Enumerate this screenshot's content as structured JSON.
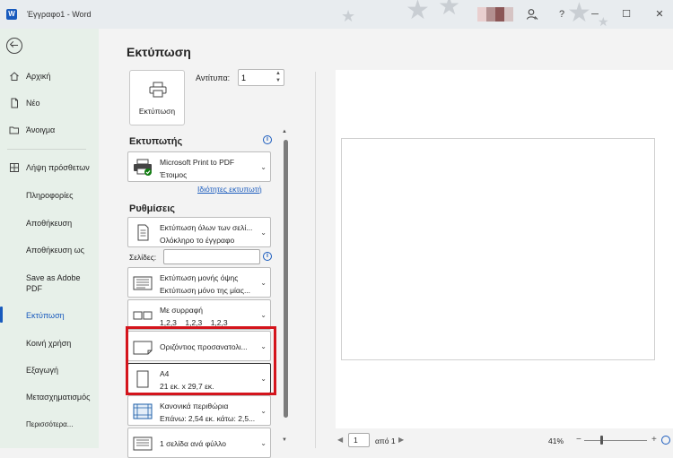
{
  "titlebar": {
    "app_letter": "W",
    "title": "Έγγραφο1 - Word",
    "help": "?",
    "minimize": "─",
    "maximize": "☐",
    "close": "✕",
    "person_icon": "person-icon"
  },
  "sidebar": {
    "back_icon": "arrow-left-circle-icon",
    "items": [
      {
        "label": "Αρχική",
        "icon": "home-icon"
      },
      {
        "label": "Νέο",
        "icon": "new-document-icon"
      },
      {
        "label": "Άνοιγμα",
        "icon": "folder-icon"
      },
      {
        "label": "Λήψη πρόσθετων",
        "icon": "apps-icon"
      },
      {
        "label": "Πληροφορίες"
      },
      {
        "label": "Αποθήκευση"
      },
      {
        "label": "Αποθήκευση ως"
      },
      {
        "label": "Save as Adobe PDF"
      },
      {
        "label": "Εκτύπωση",
        "active": true
      },
      {
        "label": "Κοινή χρήση"
      },
      {
        "label": "Εξαγωγή"
      },
      {
        "label": "Μετασχηματισμός"
      },
      {
        "label": "Περισσότερα..."
      }
    ]
  },
  "print": {
    "title": "Εκτύπωση",
    "button_label": "Εκτύπωση",
    "copies_label": "Αντίτυπα:",
    "copies_value": "1",
    "printer_section": "Εκτυπωτής",
    "printer_name": "Microsoft Print to PDF",
    "printer_status": "Έτοιμος",
    "printer_properties": "Ιδιότητες εκτυπωτή",
    "settings_section": "Ρυθμίσεις",
    "print_what_l1": "Εκτύπωση όλων των σελί...",
    "print_what_l2": "Ολόκληρο το έγγραφο",
    "pages_label": "Σελίδες:",
    "pages_value": "",
    "sides_l1": "Εκτύπωση μονής όψης",
    "sides_l2": "Εκτύπωση μόνο της μίας...",
    "collate_l1": "Με συρραφή",
    "collate_l2": "1,2,3    1,2,3    1,2,3",
    "orientation": "Οριζόντιος προσανατολι...",
    "paper_l1": "A4",
    "paper_l2": "21 εκ. x 29,7 εκ.",
    "margins_l1": "Κανονικά περιθώρια",
    "margins_l2": "Επάνω: 2,54 εκ. κάτω: 2,5...",
    "per_sheet": "1 σελίδα ανά φύλλο",
    "highlight_color": "#d4141c",
    "accent_color": "#185abd"
  },
  "preview": {
    "page_input": "1",
    "of_label": "από 1",
    "zoom": "41%",
    "zoom_level_percent": 41
  }
}
